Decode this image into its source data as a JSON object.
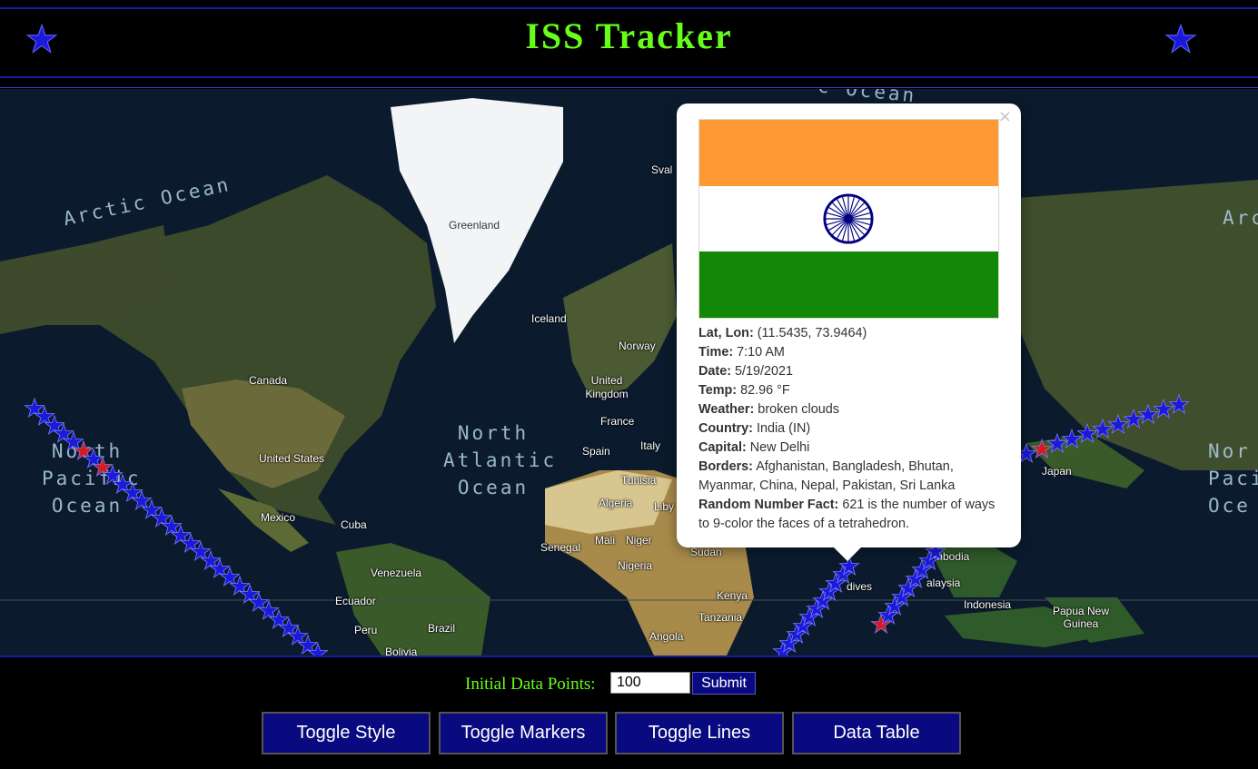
{
  "header": {
    "title": "ISS Tracker"
  },
  "map": {
    "place_labels": {
      "greenland": "Greenland",
      "iceland": "Iceland",
      "norway": "Norway",
      "svalbard": "Sval",
      "canada": "Canada",
      "uk": "United Kingdom",
      "france": "France",
      "spain": "Spain",
      "italy": "Italy",
      "tunisia": "Tunisia",
      "algeria": "Algeria",
      "libya": "Liby",
      "us": "United States",
      "mexico": "Mexico",
      "cuba": "Cuba",
      "venezuela": "Venezuela",
      "ecuador": "Ecuador",
      "peru": "Peru",
      "brazil": "Brazil",
      "bolivia": "Bolivia",
      "senegal": "Senegal",
      "mali": "Mali",
      "niger": "Niger",
      "nigeria": "Nigeria",
      "sudan": "Sudan",
      "kenya": "Kenya",
      "tanzania": "Tanzania",
      "angola": "Angola",
      "maldives": "dives",
      "cambodia": "mbodia",
      "malaysia": "alaysia",
      "indonesia": "Indonesia",
      "png": "Papua New Guinea",
      "japan": "Japan"
    },
    "ocean_labels": {
      "arctic_left": "Arctic Ocean",
      "arctic_right": "Arc",
      "arctic_top": "c Ocean",
      "north_atlantic": "North Atlantic Ocean",
      "north_pacific_left": "North Pacific Ocean",
      "north_pacific_right": "Nor Paci Oce"
    }
  },
  "popup": {
    "close_symbol": "×",
    "flag_colors": {
      "top": "#ff9933",
      "middle": "#ffffff",
      "bottom": "#138808",
      "chakra": "#000080"
    },
    "fields": [
      {
        "label": "Lat, Lon:",
        "value": "(11.5435, 73.9464)"
      },
      {
        "label": "Time:",
        "value": "7:10 AM"
      },
      {
        "label": "Date:",
        "value": "5/19/2021"
      },
      {
        "label": "Temp:",
        "value": "82.96 °F"
      },
      {
        "label": "Weather:",
        "value": "broken clouds"
      },
      {
        "label": "Country:",
        "value": "India (IN)"
      },
      {
        "label": "Capital:",
        "value": "New Delhi"
      },
      {
        "label": "Borders:",
        "value": "Afghanistan, Bangladesh, Bhutan, Myanmar, China, Nepal, Pakistan, Sri Lanka"
      },
      {
        "label": "Random Number Fact:",
        "value": "621 is the number of ways to 9-color the faces of a tetrahedron."
      }
    ]
  },
  "controls": {
    "data_points_label": "Initial Data Points:",
    "data_points_value": "100",
    "submit_label": "Submit",
    "buttons": {
      "toggle_style": "Toggle Style",
      "toggle_markers": "Toggle Markers",
      "toggle_lines": "Toggle Lines",
      "data_table": "Data Table"
    }
  },
  "colors": {
    "accent_green": "#66ff1a",
    "marker_blue": "#1a1ae0",
    "marker_red": "#e01a1a",
    "button_navy": "#0a0a80"
  },
  "icons": {
    "header_star": "star-icon",
    "marker": "iss-star-marker-icon"
  }
}
